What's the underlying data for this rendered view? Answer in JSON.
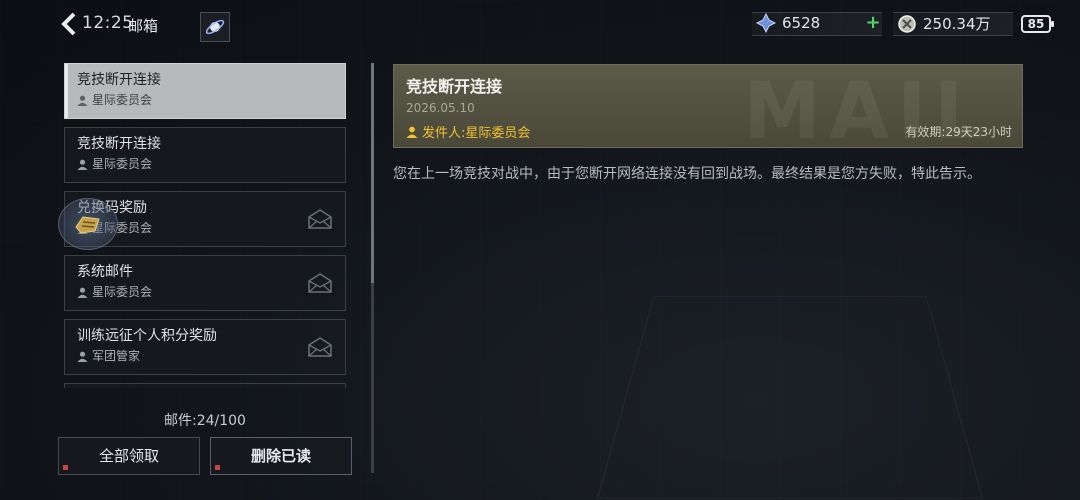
{
  "topbar": {
    "back_icon": "chevron-left-icon",
    "time": "12:25",
    "title": "邮箱",
    "planet_icon": "planet-icon",
    "resource1": {
      "icon": "crystal-icon",
      "value": "6528",
      "add": "+"
    },
    "resource2": {
      "icon": "coin-icon",
      "value": "250.34万"
    },
    "battery": "85"
  },
  "mail_list": [
    {
      "subject": "竞技断开连接",
      "sender": "星际委员会",
      "selected": true,
      "read": false
    },
    {
      "subject": "竞技断开连接",
      "sender": "星际委员会",
      "selected": false,
      "read": false
    },
    {
      "subject": "兑换码奖励",
      "sender": "星际委员会",
      "selected": false,
      "read": true
    },
    {
      "subject": "系统邮件",
      "sender": "星际委员会",
      "selected": false,
      "read": true
    },
    {
      "subject": "训练远征个人积分奖励",
      "sender": "军团管家",
      "selected": false,
      "read": true
    }
  ],
  "footer": {
    "count": "邮件:24/100",
    "claim_all": "全部领取",
    "delete_read": "删除已读"
  },
  "detail": {
    "title": "竞技断开连接",
    "date": "2026.05.10",
    "sender_label": "发件人:星际委员会",
    "expire": "有效期:29天23小时",
    "watermark": "MAIL",
    "body": "您在上一场竞技对战中，由于您断开网络连接没有回到战场。最终结果是您方失败，特此告示。"
  },
  "colors": {
    "accent_gold": "#f2c230",
    "selected_bg": "#b8b9bb",
    "header_bg": "#5c5a49",
    "plus_green": "#53d46b"
  }
}
